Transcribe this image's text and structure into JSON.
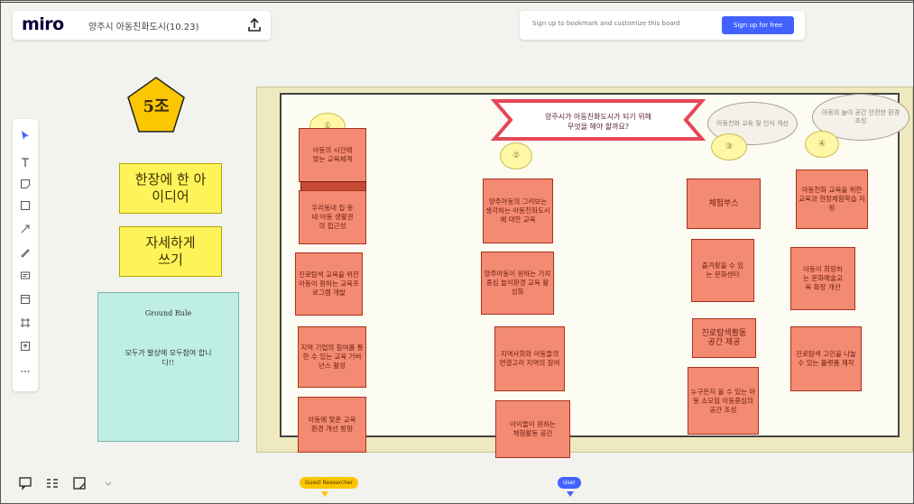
{
  "app": {
    "logo": "miro",
    "board_title": "양주시 아동친화도시(10.23)"
  },
  "signup": {
    "text": "Sign up to bookmark and customize this board",
    "button": "Sign up for free"
  },
  "pentagon": {
    "label": "5조"
  },
  "notes": {
    "one_idea": "한장에 한 아이디어",
    "write_detail": "자세하게 쓰기",
    "ground_rule_title": "Ground Rule",
    "ground_rule_body": "모두가 발상에 모두참여 합니다!!"
  },
  "question": {
    "line1": "양주시가 아동친화도시가 되기 위해",
    "line2": "무엇을 해야 할까요?"
  },
  "columns": [
    {
      "header": "①",
      "stickies": [
        "아동의 시간에 맞는 교육체계",
        "우리동네 집·동네·아동 생활권의 접근성",
        "진로탐색 교육을 위한 아동이 원하는 교육프로그램 개발",
        "지역 기업의 참여를 통한 수 있는 교육 거버넌스 활성",
        "아동에 맞춘 교육환경 개선 방향"
      ]
    },
    {
      "header": "②",
      "stickies": [
        "양주아동의 그려보는 생각하는 아동친화도시에 대한 교육",
        "양주아동이 원하는 가치중심 놀이환경 교육 활성화",
        "지역사회와 아동들의 연결고리 지역의 참여",
        "아이들이 원하는 체험활동 공간"
      ]
    },
    {
      "header": "③",
      "stickies": [
        "체험부스",
        "즐겨찾을 수 있는 문화센터",
        "진로탐색활동 공간 제공",
        "누구든지 올 수 있는 아동 소모임 아동중심의 공간 조성"
      ]
    },
    {
      "header": "④",
      "stickies": [
        "아동친화 교육을 위한 교육과 현장체험학습 지원",
        "아동이 희망하는 문화예술교육 확장 개선",
        "진로탐색 고민을 나눌 수 있는 플랫폼 제작"
      ]
    }
  ],
  "ghost_bubbles": [
    "아동친화 교육 및 인식 개선",
    "아동의 놀이 공간 안전한 환경 조성"
  ],
  "cursors": {
    "guest": "Guest Researcher",
    "user": "User"
  },
  "colors": {
    "frame_bg": "#efe9bf",
    "sticky_red": "#f28b72",
    "sticky_yellow": "#fff35a",
    "question_pink": "#e5475a",
    "accent_blue": "#4262ff"
  }
}
